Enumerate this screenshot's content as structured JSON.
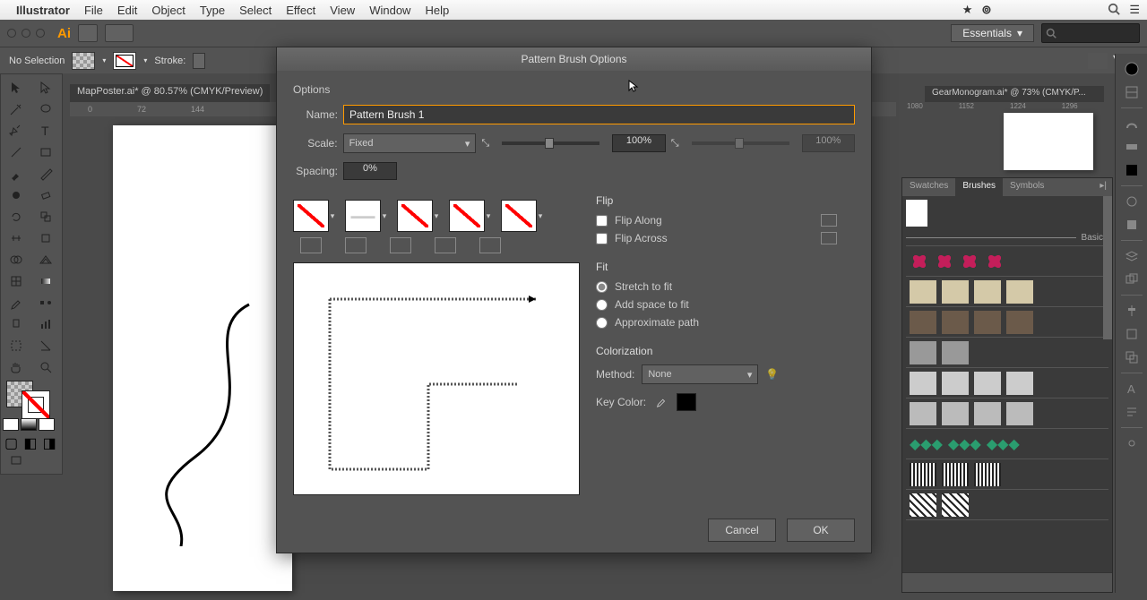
{
  "menubar": {
    "app": "Illustrator",
    "items": [
      "File",
      "Edit",
      "Object",
      "Type",
      "Select",
      "Effect",
      "View",
      "Window",
      "Help"
    ]
  },
  "workspace": "Essentials",
  "control": {
    "selection": "No Selection",
    "stroke_label": "Stroke:"
  },
  "docs": {
    "tab1": "MapPoster.ai* @ 80.57% (CMYK/Preview)",
    "tab2": "GearMonogram.ai* @ 73% (CMYK/P...",
    "ruler1": [
      "0",
      "72",
      "144"
    ],
    "ruler2": [
      "1080",
      "1152",
      "1224",
      "1296"
    ]
  },
  "dialog": {
    "title": "Pattern Brush Options",
    "options_label": "Options",
    "name_label": "Name:",
    "name_value": "Pattern Brush 1",
    "scale_label": "Scale:",
    "scale_mode": "Fixed",
    "scale_value": "100%",
    "scale_value2": "100%",
    "spacing_label": "Spacing:",
    "spacing_value": "0%",
    "flip_label": "Flip",
    "flip_along": "Flip Along",
    "flip_across": "Flip Across",
    "fit_label": "Fit",
    "fit_stretch": "Stretch to fit",
    "fit_space": "Add space to fit",
    "fit_approx": "Approximate path",
    "color_label": "Colorization",
    "method_label": "Method:",
    "method_value": "None",
    "keycolor_label": "Key Color:",
    "cancel": "Cancel",
    "ok": "OK"
  },
  "panels": {
    "swatches": "Swatches",
    "brushes": "Brushes",
    "symbols": "Symbols",
    "basic": "Basic"
  }
}
